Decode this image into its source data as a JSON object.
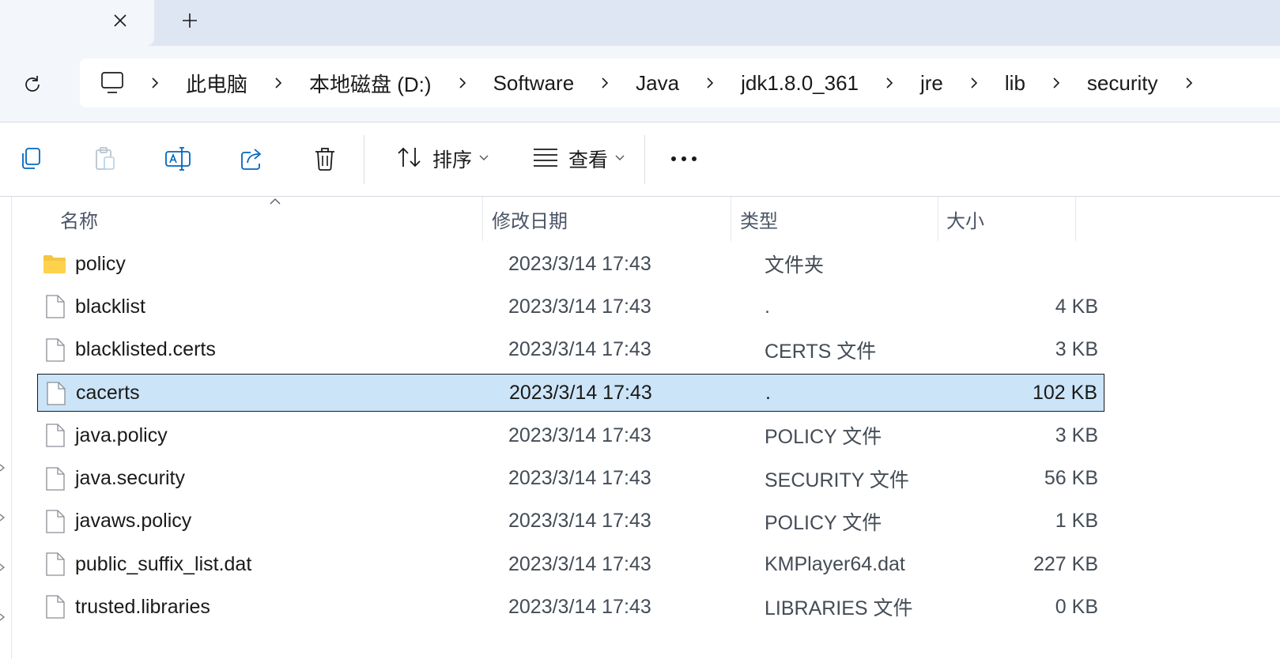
{
  "tabs": {
    "close_icon": "close-icon",
    "new_tab_icon": "plus-icon"
  },
  "address": {
    "refresh_icon": "refresh-icon",
    "root_icon": "this-pc-icon",
    "breadcrumbs": [
      "此电脑",
      "本地磁盘 (D:)",
      "Software",
      "Java",
      "jdk1.8.0_361",
      "jre",
      "lib",
      "security"
    ]
  },
  "toolbar": {
    "sort_label": "排序",
    "view_label": "查看",
    "icons": [
      "copy-icon",
      "paste-icon",
      "rename-icon",
      "share-icon",
      "delete-icon",
      "sort-icon",
      "view-icon",
      "more-icon"
    ]
  },
  "columns": {
    "name": "名称",
    "date": "修改日期",
    "type": "类型",
    "size": "大小"
  },
  "files": [
    {
      "name": "policy",
      "date": "2023/3/14 17:43",
      "type": "文件夹",
      "size": "",
      "kind": "folder",
      "selected": false
    },
    {
      "name": "blacklist",
      "date": "2023/3/14 17:43",
      "type": ".",
      "size": "4 KB",
      "kind": "file",
      "selected": false
    },
    {
      "name": "blacklisted.certs",
      "date": "2023/3/14 17:43",
      "type": "CERTS 文件",
      "size": "3 KB",
      "kind": "file",
      "selected": false
    },
    {
      "name": "cacerts",
      "date": "2023/3/14 17:43",
      "type": ".",
      "size": "102 KB",
      "kind": "file",
      "selected": true
    },
    {
      "name": "java.policy",
      "date": "2023/3/14 17:43",
      "type": "POLICY 文件",
      "size": "3 KB",
      "kind": "file",
      "selected": false
    },
    {
      "name": "java.security",
      "date": "2023/3/14 17:43",
      "type": "SECURITY 文件",
      "size": "56 KB",
      "kind": "file",
      "selected": false
    },
    {
      "name": "javaws.policy",
      "date": "2023/3/14 17:43",
      "type": "POLICY 文件",
      "size": "1 KB",
      "kind": "file",
      "selected": false
    },
    {
      "name": "public_suffix_list.dat",
      "date": "2023/3/14 17:43",
      "type": "KMPlayer64.dat",
      "size": "227 KB",
      "kind": "file",
      "selected": false
    },
    {
      "name": "trusted.libraries",
      "date": "2023/3/14 17:43",
      "type": "LIBRARIES 文件",
      "size": "0 KB",
      "kind": "file",
      "selected": false
    }
  ],
  "colors": {
    "selection_bg": "#cce4f7",
    "accent": "#0067c0",
    "tabstrip_bg": "#dfe6f3"
  }
}
